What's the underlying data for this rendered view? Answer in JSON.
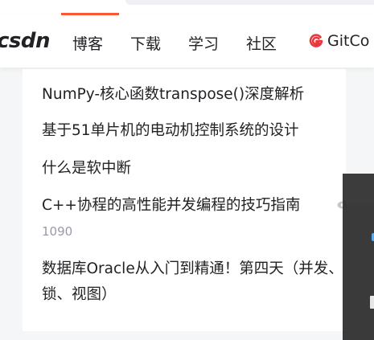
{
  "header": {
    "logo_text": "csdn",
    "nav": [
      {
        "label": "博客"
      },
      {
        "label": "下载"
      },
      {
        "label": "学习"
      },
      {
        "label": "社区"
      },
      {
        "label": "GitCo"
      }
    ],
    "gitcode_icon": "gitcode-logo-icon",
    "brand_color": "#fc5531",
    "gitcode_color": "#e8383d"
  },
  "articles": [
    {
      "title": "NumPy-核心函数transpose()深度解析"
    },
    {
      "title": "基于51单片机的电动机控制系统的设计"
    },
    {
      "title": "什么是软中断"
    },
    {
      "title": "C++协程的高性能并发编程的技巧指南",
      "views": "1090",
      "views_icon": "eye-icon"
    },
    {
      "title": "数据库Oracle从入门到精通！第四天（并发、锁、视图）"
    }
  ],
  "colors": {
    "text": "#222226",
    "muted": "#999aaa",
    "page_bg": "#f5f6f7",
    "card_bg": "#ffffff",
    "panel_bg": "#2b2b2b",
    "panel_accent": "#4aa3f0"
  }
}
